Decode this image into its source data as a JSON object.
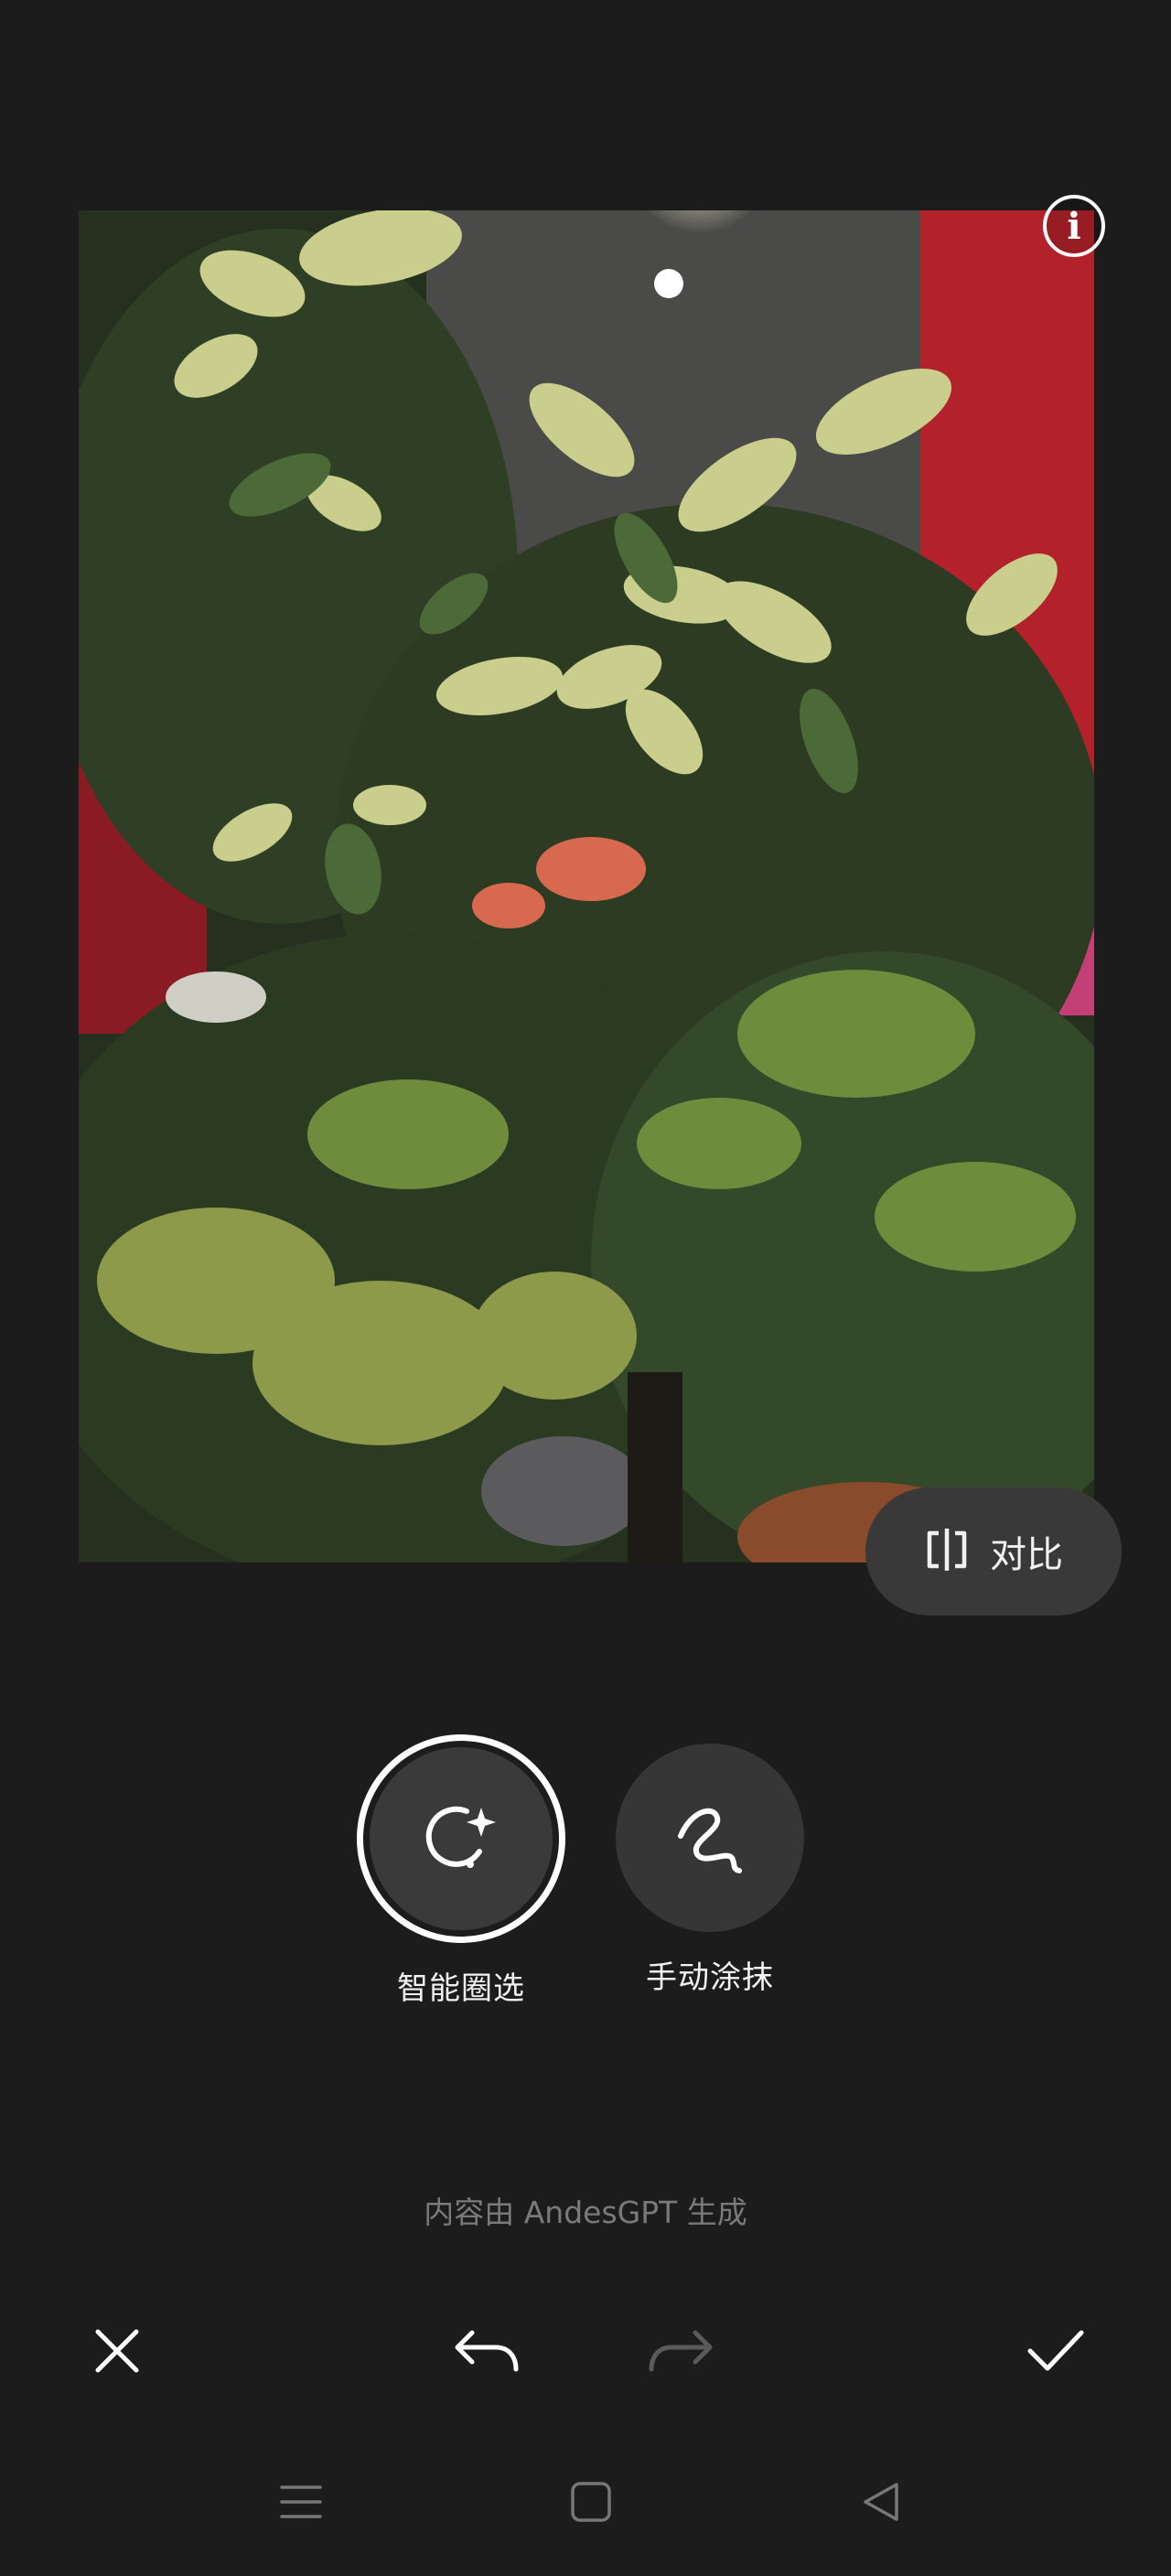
{
  "photo": {
    "description_icon": "info-icon",
    "info_glyph": "i"
  },
  "compare": {
    "label": "对比",
    "icon": "compare-split-icon"
  },
  "tools": [
    {
      "label": "智能圈选",
      "icon": "smart-lasso-sparkle-icon",
      "selected": true
    },
    {
      "label": "手动涂抹",
      "icon": "manual-brush-squiggle-icon",
      "selected": false
    }
  ],
  "credit": "内容由 AndesGPT 生成",
  "actions": {
    "close_icon": "close-icon",
    "undo_icon": "undo-icon",
    "redo_icon": "redo-icon",
    "redo_enabled": false,
    "confirm_icon": "check-icon"
  },
  "system_nav": {
    "menu_icon": "menu-icon",
    "home_icon": "home-square-icon",
    "back_icon": "back-triangle-icon"
  },
  "colors": {
    "background": "#1c1c1d",
    "button_fill": "#3a3a3b",
    "credit_text": "#7a7a7a",
    "disabled_icon": "#5a5a5a"
  }
}
